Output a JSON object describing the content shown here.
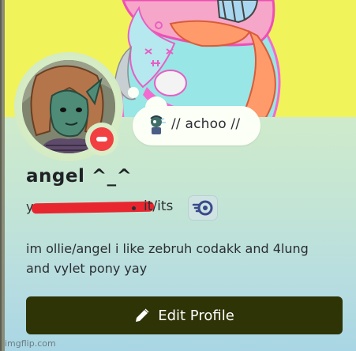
{
  "profile": {
    "display_name": "angel ^_^",
    "username_visible": "y",
    "pronouns": "it/its",
    "custom_status": "// achoo //",
    "bio": "im ollie/angel i like zebruh codakk and 4lung and vylet pony yay",
    "status": "do-not-disturb"
  },
  "actions": {
    "edit_profile_label": "Edit Profile"
  },
  "icons": {
    "status_emoji": "sneezing-character-emoji",
    "badge": "nitro-badge-icon",
    "edit": "pencil-icon",
    "status_indicator": "do-not-disturb-icon"
  },
  "watermark": "imgflip.com",
  "colors": {
    "banner": "#f1f35a",
    "button": "#2e3406",
    "dnd": "#f23f42",
    "redaction": "#e8262f"
  }
}
